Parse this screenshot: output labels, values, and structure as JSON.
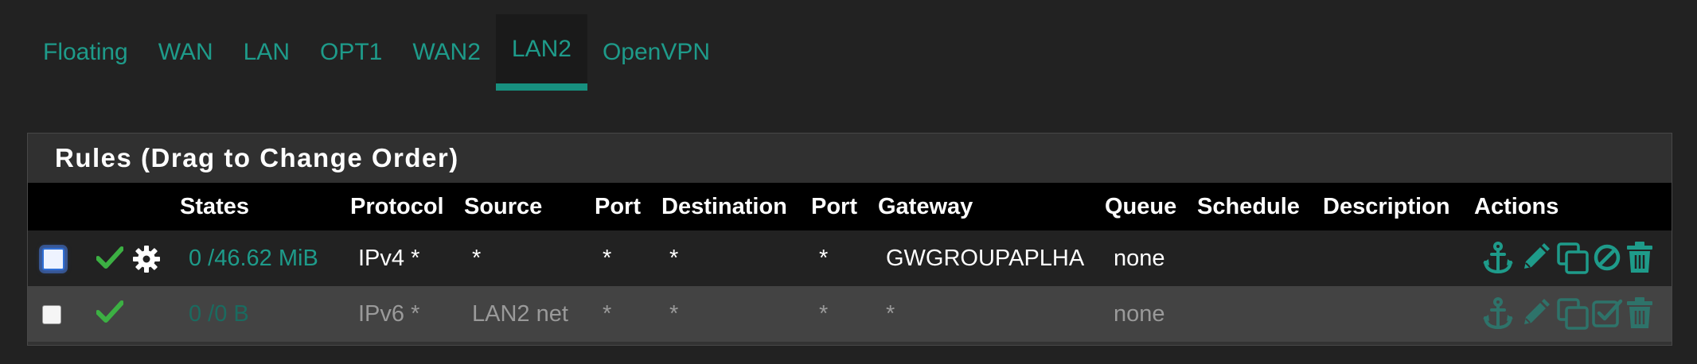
{
  "tabs": [
    {
      "label": "Floating",
      "active": false
    },
    {
      "label": "WAN",
      "active": false
    },
    {
      "label": "LAN",
      "active": false
    },
    {
      "label": "OPT1",
      "active": false
    },
    {
      "label": "WAN2",
      "active": false
    },
    {
      "label": "LAN2",
      "active": true
    },
    {
      "label": "OpenVPN",
      "active": false
    }
  ],
  "panel": {
    "title": "Rules (Drag to Change Order)"
  },
  "columns": {
    "states": "States",
    "protocol": "Protocol",
    "source": "Source",
    "port1": "Port",
    "destination": "Destination",
    "port2": "Port",
    "gateway": "Gateway",
    "queue": "Queue",
    "schedule": "Schedule",
    "description": "Description",
    "actions": "Actions"
  },
  "rules": [
    {
      "selected": true,
      "enabled": true,
      "advanced": true,
      "states": "0 /46.62 MiB",
      "protocol": "IPv4 *",
      "source": "*",
      "port1": "*",
      "destination": "*",
      "port2": "*",
      "gateway": "GWGROUPAPLHA",
      "queue": "none",
      "schedule": "",
      "description": "",
      "actions": [
        "anchor-icon",
        "pencil-icon",
        "copy-icon",
        "ban-icon",
        "trash-icon"
      ]
    },
    {
      "selected": false,
      "enabled": true,
      "advanced": false,
      "states": "0 /0 B",
      "protocol": "IPv6 *",
      "source": "LAN2 net",
      "port1": "*",
      "destination": "*",
      "port2": "*",
      "gateway": "*",
      "queue": "none",
      "schedule": "",
      "description": "",
      "actions": [
        "anchor-icon",
        "pencil-icon",
        "copy-icon",
        "check-square-icon",
        "trash-icon"
      ]
    }
  ],
  "colors": {
    "accent": "#1e9b8a",
    "check": "#3cb043",
    "background": "#222222",
    "header": "#000000"
  }
}
